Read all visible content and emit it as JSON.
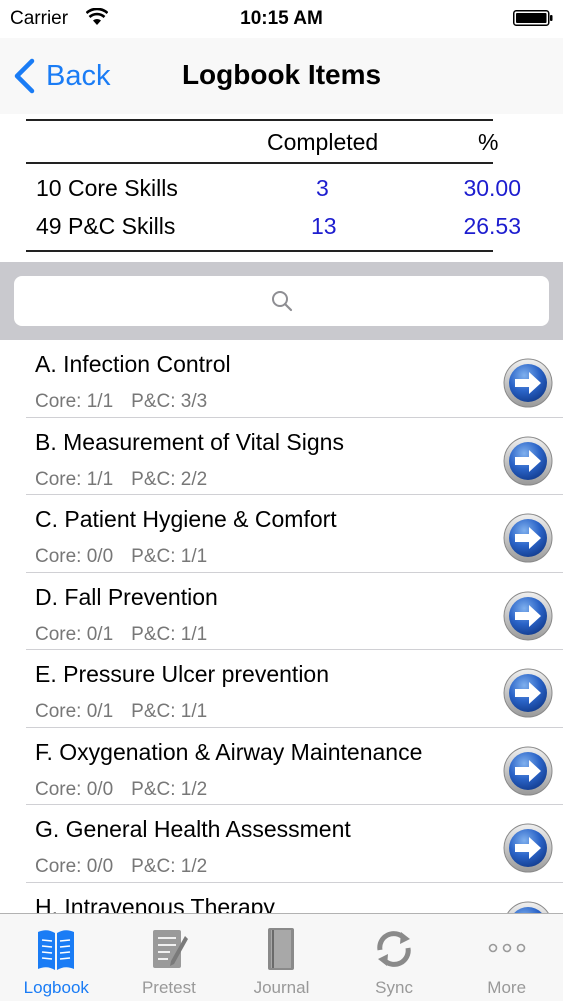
{
  "status_bar": {
    "carrier": "Carrier",
    "time": "10:15 AM"
  },
  "nav": {
    "back_label": "Back",
    "title": "Logbook Items"
  },
  "summary": {
    "header_completed": "Completed",
    "header_percent": "%",
    "rows": [
      {
        "label": "10 Core Skills",
        "completed": "3",
        "percent": "30.00"
      },
      {
        "label": "49 P&C Skills",
        "completed": "13",
        "percent": "26.53"
      }
    ]
  },
  "search": {
    "placeholder": ""
  },
  "items": [
    {
      "title": "A. Infection Control",
      "core": "Core: 1/1",
      "pc": "P&C: 3/3"
    },
    {
      "title": "B. Measurement of Vital Signs",
      "core": "Core: 1/1",
      "pc": "P&C: 2/2"
    },
    {
      "title": "C. Patient Hygiene & Comfort",
      "core": "Core: 0/0",
      "pc": "P&C: 1/1"
    },
    {
      "title": "D. Fall Prevention",
      "core": "Core: 0/1",
      "pc": "P&C: 1/1"
    },
    {
      "title": "E. Pressure Ulcer prevention",
      "core": "Core: 0/1",
      "pc": "P&C: 1/1"
    },
    {
      "title": "F. Oxygenation & Airway Maintenance",
      "core": "Core: 0/0",
      "pc": "P&C: 1/2"
    },
    {
      "title": "G. General Health Assessment",
      "core": "Core: 0/0",
      "pc": "P&C: 1/2"
    },
    {
      "title": "H. Intravenous Therapy",
      "core": "",
      "pc": ""
    }
  ],
  "tabs": [
    {
      "label": "Logbook",
      "icon": "logbook-icon",
      "active": true
    },
    {
      "label": "Pretest",
      "icon": "pretest-icon",
      "active": false
    },
    {
      "label": "Journal",
      "icon": "journal-icon",
      "active": false
    },
    {
      "label": "Sync",
      "icon": "sync-icon",
      "active": false
    },
    {
      "label": "More",
      "icon": "more-icon",
      "active": false
    }
  ],
  "colors": {
    "accent": "#1a7cf5",
    "value_blue": "#1d1dcf",
    "secondary_text": "#777777"
  }
}
